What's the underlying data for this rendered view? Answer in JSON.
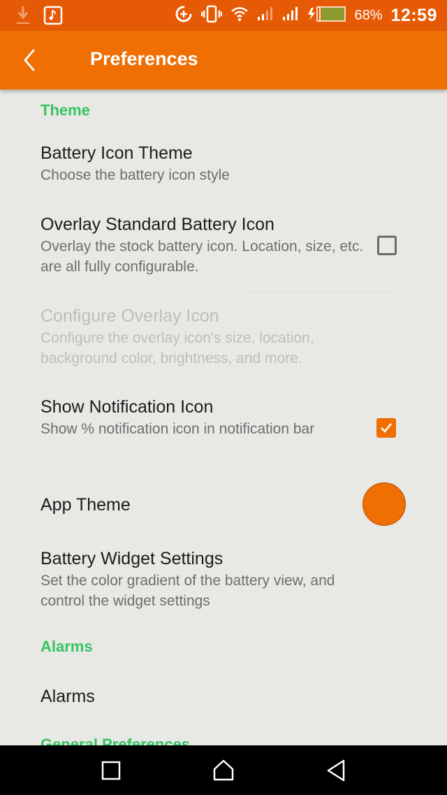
{
  "status_bar": {
    "battery_percent": "68%",
    "time": "12:59",
    "battery_level": 0.68,
    "icons": [
      "download-icon",
      "music-note-icon",
      "data-saver-icon",
      "vibrate-icon",
      "wifi-icon",
      "signal-sim1-icon",
      "signal-sim2-icon",
      "charging-icon",
      "battery-icon"
    ]
  },
  "app_bar": {
    "title": "Preferences",
    "back_icon": "chevron-left-icon"
  },
  "sections": [
    {
      "header": "Theme",
      "items": [
        {
          "title": "Battery Icon Theme",
          "summary": "Choose the battery icon style"
        },
        {
          "title": "Overlay Standard Battery Icon",
          "summary": "Overlay the stock battery icon. Location, size, etc. are all fully configurable.",
          "checked": false
        },
        {
          "title": "Configure Overlay Icon",
          "summary": "Configure the overlay icon's size, location, background color, brightness, and more.",
          "enabled": false
        },
        {
          "title": "Show Notification Icon",
          "summary": "Show % notification icon in notification bar",
          "checked": true
        },
        {
          "title": "App Theme",
          "color": "#ef6f03"
        },
        {
          "title": "Battery Widget Settings",
          "summary": "Set the color gradient of the battery view, and control the widget settings"
        }
      ]
    },
    {
      "header": "Alarms",
      "items": [
        {
          "title": "Alarms"
        }
      ]
    },
    {
      "header": "General Preferences",
      "items": []
    }
  ],
  "colors": {
    "status_bar": "#e65a05",
    "app_bar": "#ef6f03",
    "accent": "#ef6f03",
    "section_header": "#37c463",
    "background": "#e8e8e5"
  },
  "nav_bar": {
    "icons": [
      "recents-icon",
      "home-icon",
      "back-icon"
    ]
  }
}
